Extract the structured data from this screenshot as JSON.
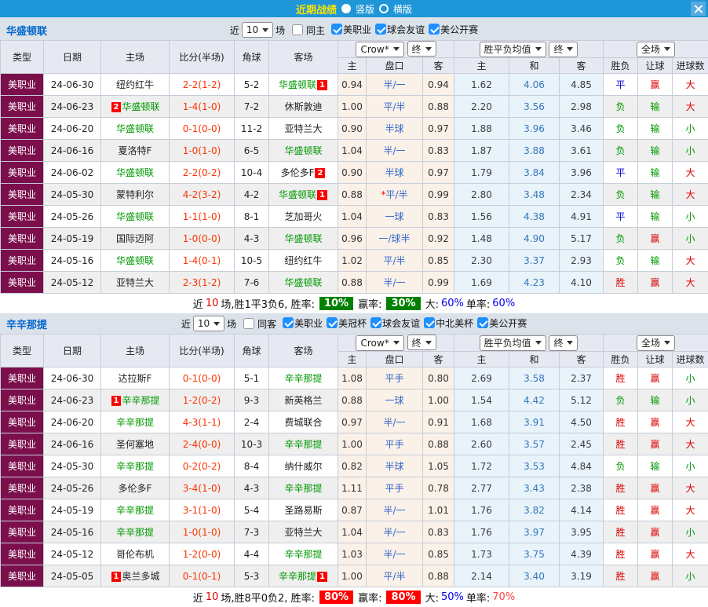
{
  "titlebar": {
    "title": "近期战绩",
    "vertical": "竖版",
    "horizontal": "横版"
  },
  "colors": {
    "titlebar_blue": "#1E96D8",
    "league_maroon": "#7B0F4C",
    "self_team_green": "#009900",
    "score_red": "#FF3300",
    "handicap_blue": "#3366CC",
    "win_red": "#DD0000",
    "draw_blue": "#0000DD",
    "lose_green": "#009900",
    "checkbox_blue": "#1E90FF",
    "summary_badge_green": "#008000",
    "summary_badge_red": "#FF0000"
  },
  "columns": {
    "type": "类型",
    "date": "日期",
    "home": "主场",
    "score": "比分(半场)",
    "corner": "角球",
    "away": "客场",
    "odds_select": "Crow*",
    "odds_final": "终",
    "avg_select": "胜平负均值",
    "avg_final": "终",
    "scope_select": "全场",
    "sub": {
      "home_odds": "主",
      "handicap": "盘口",
      "away_odds": "客",
      "avg_home": "主",
      "avg_draw": "和",
      "avg_away": "客",
      "result": "胜负",
      "handicap_result": "让球",
      "goals": "进球数"
    }
  },
  "sections": [
    {
      "team": "华盛顿联",
      "filter": {
        "near": "近",
        "count": "10",
        "matches": "场",
        "same": "同主",
        "leagues": [
          "美职业",
          "球会友谊",
          "美公开赛"
        ]
      },
      "rows": [
        {
          "lg": "美职业",
          "dt": "24-06-30",
          "hm": {
            "n": "纽约红牛"
          },
          "sc": "2-2(1-2)",
          "cn": "5-2",
          "aw": {
            "n": "华盛顿联",
            "self": true,
            "b": "1"
          },
          "o": [
            "0.94",
            "半/一",
            "0.94"
          ],
          "m": [
            "1.62",
            "4.06",
            "4.85"
          ],
          "res": [
            "平",
            "赢",
            "大"
          ]
        },
        {
          "lg": "美职业",
          "dt": "24-06-23",
          "hm": {
            "n": "华盛顿联",
            "self": true,
            "b": "2"
          },
          "sc": "1-4(1-0)",
          "cn": "7-2",
          "aw": {
            "n": "休斯敦迪"
          },
          "o": [
            "1.00",
            "平/半",
            "0.88"
          ],
          "m": [
            "2.20",
            "3.56",
            "2.98"
          ],
          "res": [
            "负",
            "输",
            "大"
          ]
        },
        {
          "lg": "美职业",
          "dt": "24-06-20",
          "hm": {
            "n": "华盛顿联",
            "self": true
          },
          "sc": "0-1(0-0)",
          "cn": "11-2",
          "aw": {
            "n": "亚特兰大"
          },
          "o": [
            "0.90",
            "半球",
            "0.97"
          ],
          "m": [
            "1.88",
            "3.96",
            "3.46"
          ],
          "res": [
            "负",
            "输",
            "小"
          ]
        },
        {
          "lg": "美职业",
          "dt": "24-06-16",
          "hm": {
            "n": "夏洛特F"
          },
          "sc": "1-0(1-0)",
          "cn": "6-5",
          "aw": {
            "n": "华盛顿联",
            "self": true
          },
          "o": [
            "1.04",
            "半/一",
            "0.83"
          ],
          "m": [
            "1.87",
            "3.88",
            "3.61"
          ],
          "res": [
            "负",
            "输",
            "小"
          ]
        },
        {
          "lg": "美职业",
          "dt": "24-06-02",
          "hm": {
            "n": "华盛顿联",
            "self": true
          },
          "sc": "2-2(0-2)",
          "cn": "10-4",
          "aw": {
            "n": "多伦多F",
            "b": "2"
          },
          "o": [
            "0.90",
            "半球",
            "0.97"
          ],
          "m": [
            "1.79",
            "3.84",
            "3.96"
          ],
          "res": [
            "平",
            "输",
            "大"
          ]
        },
        {
          "lg": "美职业",
          "dt": "24-05-30",
          "hm": {
            "n": "蒙特利尔"
          },
          "sc": "4-2(3-2)",
          "cn": "4-2",
          "aw": {
            "n": "华盛顿联",
            "self": true,
            "b": "1"
          },
          "o": [
            "0.88",
            "平/半",
            "0.99"
          ],
          "star": true,
          "m": [
            "2.80",
            "3.48",
            "2.34"
          ],
          "res": [
            "负",
            "输",
            "大"
          ]
        },
        {
          "lg": "美职业",
          "dt": "24-05-26",
          "hm": {
            "n": "华盛顿联",
            "self": true
          },
          "sc": "1-1(1-0)",
          "cn": "8-1",
          "aw": {
            "n": "芝加哥火"
          },
          "o": [
            "1.04",
            "一球",
            "0.83"
          ],
          "m": [
            "1.56",
            "4.38",
            "4.91"
          ],
          "res": [
            "平",
            "输",
            "小"
          ]
        },
        {
          "lg": "美职业",
          "dt": "24-05-19",
          "hm": {
            "n": "国际迈阿"
          },
          "sc": "1-0(0-0)",
          "cn": "4-3",
          "aw": {
            "n": "华盛顿联",
            "self": true
          },
          "o": [
            "0.96",
            "一/球半",
            "0.92"
          ],
          "m": [
            "1.48",
            "4.90",
            "5.17"
          ],
          "res": [
            "负",
            "赢",
            "小"
          ]
        },
        {
          "lg": "美职业",
          "dt": "24-05-16",
          "hm": {
            "n": "华盛顿联",
            "self": true
          },
          "sc": "1-4(0-1)",
          "cn": "10-5",
          "aw": {
            "n": "纽约红牛"
          },
          "o": [
            "1.02",
            "平/半",
            "0.85"
          ],
          "m": [
            "2.30",
            "3.37",
            "2.93"
          ],
          "res": [
            "负",
            "输",
            "大"
          ]
        },
        {
          "lg": "美职业",
          "dt": "24-05-12",
          "hm": {
            "n": "亚特兰大"
          },
          "sc": "2-3(1-2)",
          "cn": "7-6",
          "aw": {
            "n": "华盛顿联",
            "self": true
          },
          "o": [
            "0.88",
            "半/一",
            "0.99"
          ],
          "m": [
            "1.69",
            "4.23",
            "4.10"
          ],
          "res": [
            "胜",
            "赢",
            "大"
          ]
        }
      ],
      "summary": {
        "t1": "近",
        "num": "10",
        "t2": "场,胜1平3负6, 胜率:",
        "r1": "10%",
        "t3": "赢率:",
        "r2": "30%",
        "t4": "大:",
        "r3": "60%",
        "t5": "单率:",
        "r4": "60%",
        "badge_color": "#008000",
        "big_color": "#0000EE",
        "single_color": "#0000EE"
      }
    },
    {
      "team": "辛辛那提",
      "filter": {
        "near": "近",
        "count": "10",
        "matches": "场",
        "same": "同客",
        "leagues": [
          "美职业",
          "美冠杯",
          "球会友谊",
          "中北美杯",
          "美公开赛"
        ]
      },
      "rows": [
        {
          "lg": "美职业",
          "dt": "24-06-30",
          "hm": {
            "n": "达拉斯F"
          },
          "sc": "0-1(0-0)",
          "cn": "5-1",
          "aw": {
            "n": "辛辛那提",
            "self": true
          },
          "o": [
            "1.08",
            "平手",
            "0.80"
          ],
          "m": [
            "2.69",
            "3.58",
            "2.37"
          ],
          "res": [
            "胜",
            "赢",
            "小"
          ]
        },
        {
          "lg": "美职业",
          "dt": "24-06-23",
          "hm": {
            "n": "辛辛那提",
            "self": true,
            "b": "1"
          },
          "sc": "1-2(0-2)",
          "cn": "9-3",
          "aw": {
            "n": "新英格兰"
          },
          "o": [
            "0.88",
            "一球",
            "1.00"
          ],
          "m": [
            "1.54",
            "4.42",
            "5.12"
          ],
          "res": [
            "负",
            "输",
            "小"
          ]
        },
        {
          "lg": "美职业",
          "dt": "24-06-20",
          "hm": {
            "n": "辛辛那提",
            "self": true
          },
          "sc": "4-3(1-1)",
          "cn": "2-4",
          "aw": {
            "n": "费城联合"
          },
          "o": [
            "0.97",
            "半/一",
            "0.91"
          ],
          "m": [
            "1.68",
            "3.91",
            "4.50"
          ],
          "res": [
            "胜",
            "赢",
            "大"
          ]
        },
        {
          "lg": "美职业",
          "dt": "24-06-16",
          "hm": {
            "n": "圣何塞地"
          },
          "sc": "2-4(0-0)",
          "cn": "10-3",
          "aw": {
            "n": "辛辛那提",
            "self": true
          },
          "o": [
            "1.00",
            "平手",
            "0.88"
          ],
          "m": [
            "2.60",
            "3.57",
            "2.45"
          ],
          "res": [
            "胜",
            "赢",
            "大"
          ]
        },
        {
          "lg": "美职业",
          "dt": "24-05-30",
          "hm": {
            "n": "辛辛那提",
            "self": true
          },
          "sc": "0-2(0-2)",
          "cn": "8-4",
          "aw": {
            "n": "纳什威尔"
          },
          "o": [
            "0.82",
            "半球",
            "1.05"
          ],
          "m": [
            "1.72",
            "3.53",
            "4.84"
          ],
          "res": [
            "负",
            "输",
            "小"
          ]
        },
        {
          "lg": "美职业",
          "dt": "24-05-26",
          "hm": {
            "n": "多伦多F"
          },
          "sc": "3-4(1-0)",
          "cn": "4-3",
          "aw": {
            "n": "辛辛那提",
            "self": true
          },
          "o": [
            "1.11",
            "平手",
            "0.78"
          ],
          "m": [
            "2.77",
            "3.43",
            "2.38"
          ],
          "res": [
            "胜",
            "赢",
            "大"
          ]
        },
        {
          "lg": "美职业",
          "dt": "24-05-19",
          "hm": {
            "n": "辛辛那提",
            "self": true
          },
          "sc": "3-1(1-0)",
          "cn": "5-4",
          "aw": {
            "n": "圣路易斯"
          },
          "o": [
            "0.87",
            "半/一",
            "1.01"
          ],
          "m": [
            "1.76",
            "3.82",
            "4.14"
          ],
          "res": [
            "胜",
            "赢",
            "大"
          ]
        },
        {
          "lg": "美职业",
          "dt": "24-05-16",
          "hm": {
            "n": "辛辛那提",
            "self": true
          },
          "sc": "1-0(1-0)",
          "cn": "7-3",
          "aw": {
            "n": "亚特兰大"
          },
          "o": [
            "1.04",
            "半/一",
            "0.83"
          ],
          "m": [
            "1.76",
            "3.97",
            "3.95"
          ],
          "res": [
            "胜",
            "赢",
            "小"
          ]
        },
        {
          "lg": "美职业",
          "dt": "24-05-12",
          "hm": {
            "n": "哥伦布机"
          },
          "sc": "1-2(0-0)",
          "cn": "4-4",
          "aw": {
            "n": "辛辛那提",
            "self": true
          },
          "o": [
            "1.03",
            "半/一",
            "0.85"
          ],
          "m": [
            "1.73",
            "3.75",
            "4.39"
          ],
          "res": [
            "胜",
            "赢",
            "大"
          ]
        },
        {
          "lg": "美职业",
          "dt": "24-05-05",
          "hm": {
            "n": "奥兰多城",
            "b": "1"
          },
          "sc": "0-1(0-1)",
          "cn": "5-3",
          "aw": {
            "n": "辛辛那提",
            "self": true,
            "b": "1"
          },
          "o": [
            "1.00",
            "平/半",
            "0.88"
          ],
          "m": [
            "2.14",
            "3.40",
            "3.19"
          ],
          "res": [
            "胜",
            "赢",
            "小"
          ]
        }
      ],
      "summary": {
        "t1": "近",
        "num": "10",
        "t2": "场,胜8平0负2, 胜率:",
        "r1": "80%",
        "t3": "赢率:",
        "r2": "80%",
        "t4": "大:",
        "r3": "50%",
        "t5": "单率:",
        "r4": "70%",
        "badge_color": "#FF0000",
        "big_color": "#0000EE",
        "single_color": "#FF4040"
      }
    }
  ]
}
